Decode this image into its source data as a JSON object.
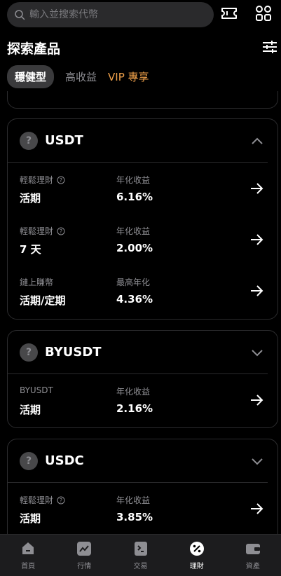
{
  "search": {
    "placeholder": "輸入並搜索代幣"
  },
  "page_title": "探索產品",
  "tabs": [
    {
      "label": "穩健型"
    },
    {
      "label": "高收益"
    },
    {
      "label": "VIP 專享"
    }
  ],
  "cards": [
    {
      "coin": "USDT",
      "coin_icon": "?",
      "rows": [
        {
          "label": "輕鬆理財",
          "term": "活期",
          "yield_label": "年化收益",
          "yield": "6.16%"
        },
        {
          "label": "輕鬆理財",
          "term": "7 天",
          "yield_label": "年化收益",
          "yield": "2.00%"
        },
        {
          "label": "鏈上賺幣",
          "term": "活期/定期",
          "yield_label": "最高年化",
          "yield": "4.36%"
        }
      ]
    },
    {
      "coin": "BYUSDT",
      "coin_icon": "?",
      "rows": [
        {
          "label": "BYUSDT",
          "term": "活期",
          "yield_label": "年化收益",
          "yield": "2.16%"
        }
      ]
    },
    {
      "coin": "USDC",
      "coin_icon": "?",
      "rows": [
        {
          "label": "輕鬆理財",
          "term": "活期",
          "yield_label": "年化收益",
          "yield": "3.85%"
        }
      ]
    }
  ],
  "nav": [
    {
      "label": "首頁",
      "icon": "home-icon"
    },
    {
      "label": "行情",
      "icon": "chart-icon"
    },
    {
      "label": "交易",
      "icon": "trade-icon"
    },
    {
      "label": "理財",
      "icon": "earn-icon"
    },
    {
      "label": "資產",
      "icon": "wallet-icon"
    }
  ]
}
